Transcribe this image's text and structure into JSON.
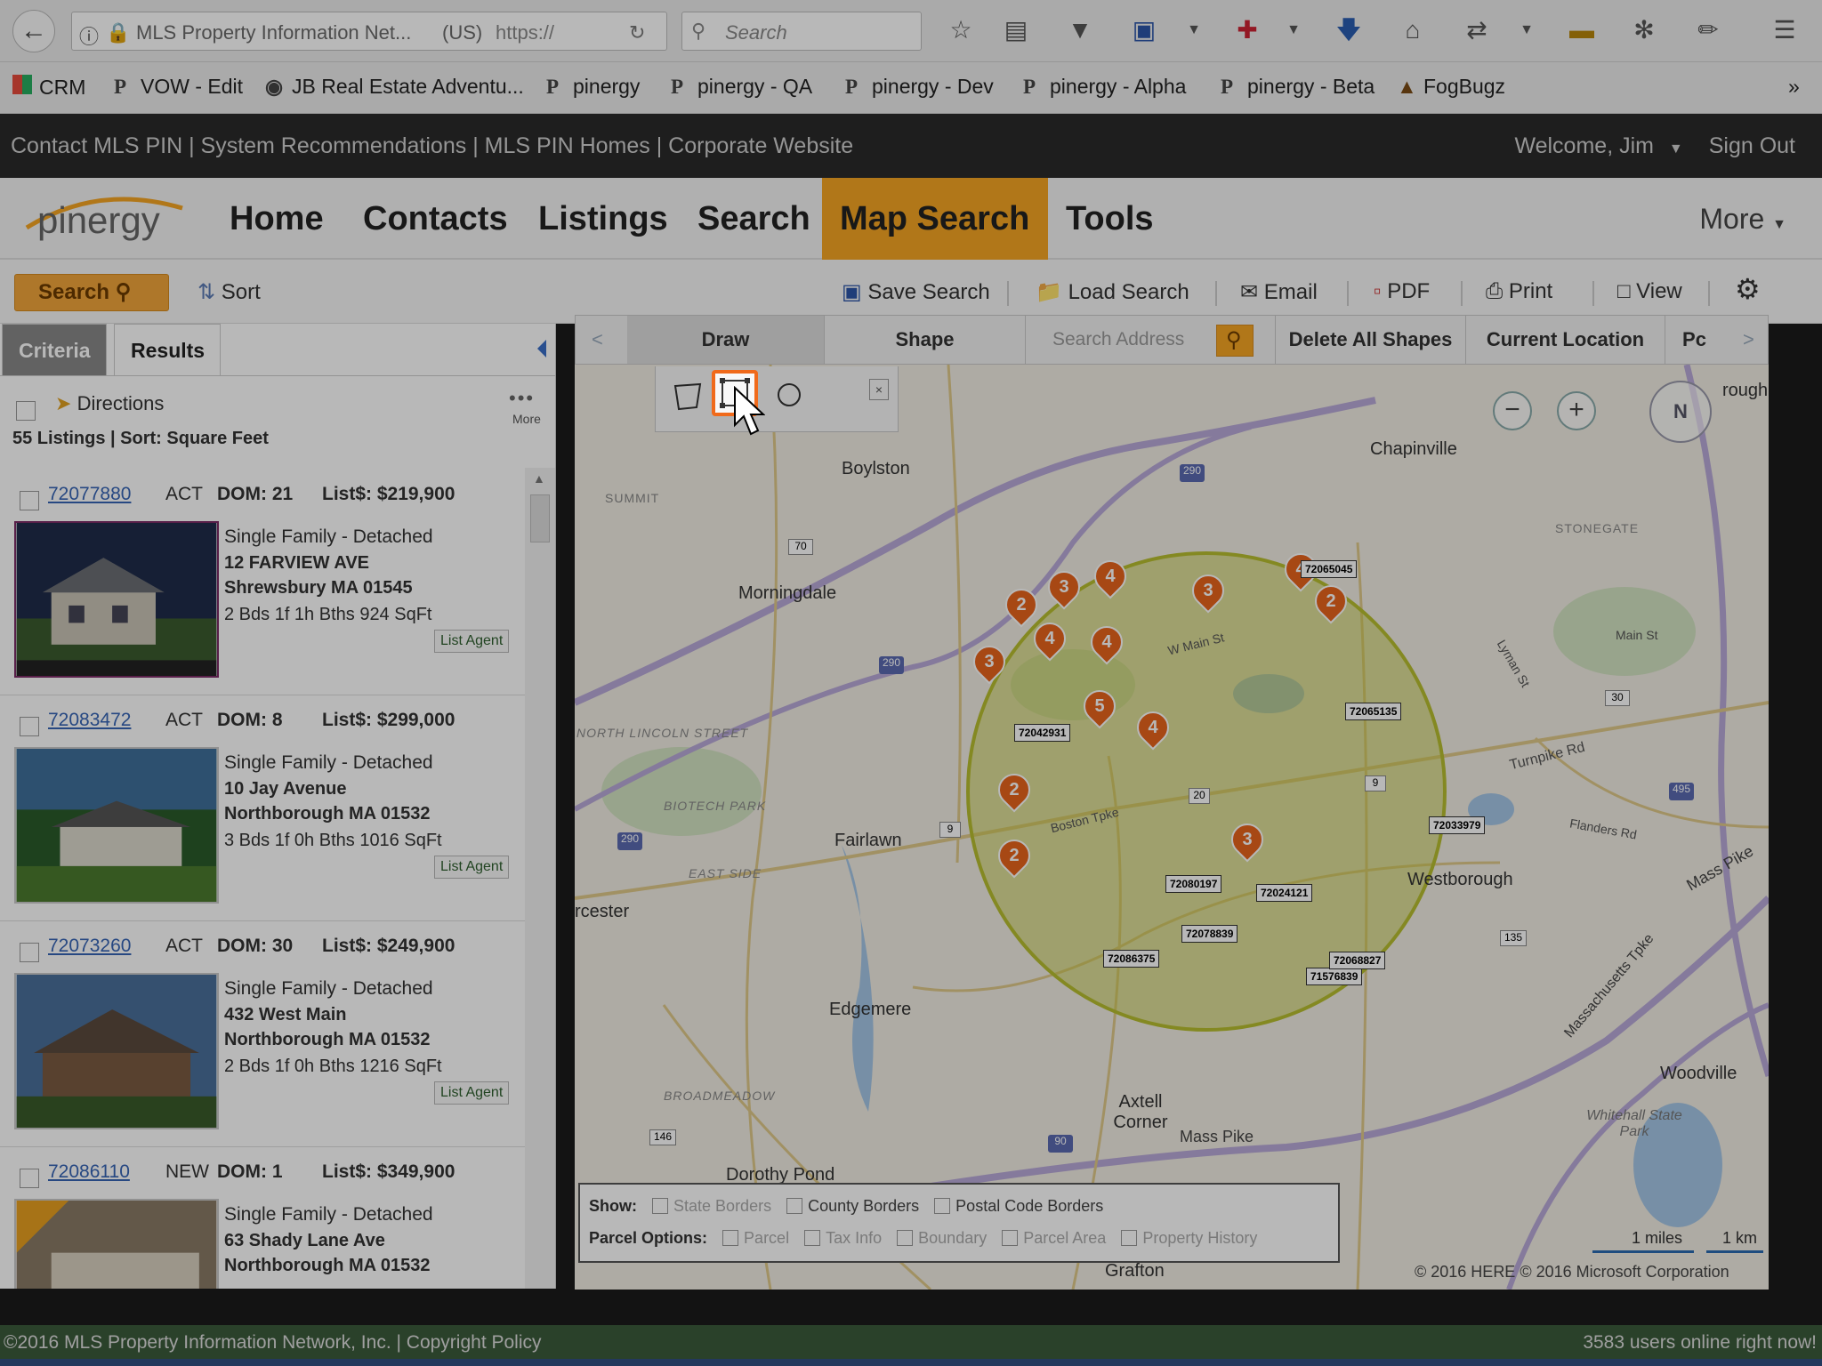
{
  "browser": {
    "url_site": "MLS Property Information Net...",
    "url_region": "(US)",
    "url_scheme": "https://",
    "search_placeholder": "Search",
    "bookmarks": [
      "CRM",
      "VOW - Edit",
      "JB Real Estate Adventu...",
      "pinergy",
      "pinergy - QA",
      "pinergy - Dev",
      "pinergy - Alpha",
      "pinergy - Beta",
      "FogBugz"
    ]
  },
  "site": {
    "top_links": "Contact MLS PIN | System Recommendations | MLS PIN Homes | Corporate Website",
    "welcome": "Welcome, Jim",
    "sign_out": "Sign Out",
    "logo": "pinergy",
    "nav": [
      "Home",
      "Contacts",
      "Listings",
      "Search",
      "Map Search",
      "Tools"
    ],
    "nav_more": "More"
  },
  "toolbar": {
    "search": "Search",
    "sort": "Sort",
    "save_search": "Save Search",
    "load_search": "Load Search",
    "email": "Email",
    "pdf": "PDF",
    "print": "Print",
    "view": "View"
  },
  "left_panel": {
    "tab_criteria": "Criteria",
    "tab_results": "Results",
    "directions": "Directions",
    "more": "More",
    "summary": "55 Listings | Sort: Square Feet",
    "listings": [
      {
        "mls": "72077880",
        "status": "ACT",
        "dom": "DOM: 21",
        "price": "List$: $219,900",
        "type": "Single Family - Detached",
        "address": "12 FARVIEW AVE",
        "city": "Shrewsbury MA 01545",
        "details": "2 Bds 1f 1h Bths 924 SqFt",
        "agent": "List Agent"
      },
      {
        "mls": "72083472",
        "status": "ACT",
        "dom": "DOM: 8",
        "price": "List$: $299,000",
        "type": "Single Family - Detached",
        "address": "10 Jay Avenue",
        "city": "Northborough MA 01532",
        "details": "3 Bds 1f 0h Bths 1016 SqFt",
        "agent": "List Agent"
      },
      {
        "mls": "72073260",
        "status": "ACT",
        "dom": "DOM: 30",
        "price": "List$: $249,900",
        "type": "Single Family - Detached",
        "address": "432 West Main",
        "city": "Northborough MA 01532",
        "details": "2 Bds 1f 0h Bths 1216 SqFt",
        "agent": "List Agent"
      },
      {
        "mls": "72086110",
        "status": "NEW",
        "dom": "DOM: 1",
        "price": "List$: $349,900",
        "type": "Single Family - Detached",
        "address": "63 Shady Lane Ave",
        "city": "Northborough MA 01532",
        "details": "",
        "agent": ""
      }
    ]
  },
  "map_tabs": {
    "draw": "Draw",
    "shape": "Shape",
    "search_address_placeholder": "Search Address",
    "delete_all": "Delete All Shapes",
    "current_location": "Current Location",
    "more": "Pc"
  },
  "map": {
    "places": [
      "Boylston",
      "Chapinville",
      "Morningdale",
      "Fairlawn",
      "Westborough",
      "Edgemere",
      "Axtell Corner",
      "Woodville",
      "Dorothy Pond",
      "Grafton",
      "rcester",
      "STONEGATE",
      "SUMMIT",
      "NORTH LINCOLN STREET",
      "BIOTECH PARK",
      "EAST SIDE",
      "BROADMEADOW",
      "Whitehall State Park",
      "rough"
    ],
    "road_labels": [
      "Mass Pike",
      "Mass Pike",
      "Massachusetts Tpke",
      "Turnpike Rd",
      "Boston Tpke",
      "W Main St",
      "Main St",
      "Flanders Rd",
      "Lyman St"
    ],
    "highway_shields": [
      "290",
      "290",
      "290",
      "70",
      "9",
      "20",
      "9",
      "30",
      "135",
      "146",
      "495",
      "90"
    ],
    "clusters": [
      "2",
      "3",
      "4",
      "4",
      "4",
      "3",
      "4",
      "2",
      "3",
      "5",
      "4",
      "2",
      "2",
      "3"
    ],
    "pin_labels": [
      "72065045",
      "72065135",
      "72042931",
      "72033979",
      "72080197",
      "72024121",
      "72078839",
      "72086375",
      "71576839",
      "72068827"
    ],
    "scale_miles": "1 miles",
    "scale_km": "1 km",
    "copyright": "© 2016 HERE   © 2016 Microsoft Corporation",
    "layers": {
      "show_label": "Show:",
      "show": [
        "State Borders",
        "County Borders",
        "Postal Code Borders"
      ],
      "parcel_label": "Parcel Options:",
      "parcel": [
        "Parcel",
        "Tax Info",
        "Boundary",
        "Parcel Area",
        "Property History"
      ]
    }
  },
  "footer": {
    "left": "©2016 MLS Property Information Network, Inc.  |  Copyright Policy",
    "right": "3583 users online right now!"
  },
  "colors": {
    "accent": "#f5a623",
    "footer": "#3b5a3b",
    "highlight": "#f06a1b",
    "circle": "#c6cc3c"
  }
}
